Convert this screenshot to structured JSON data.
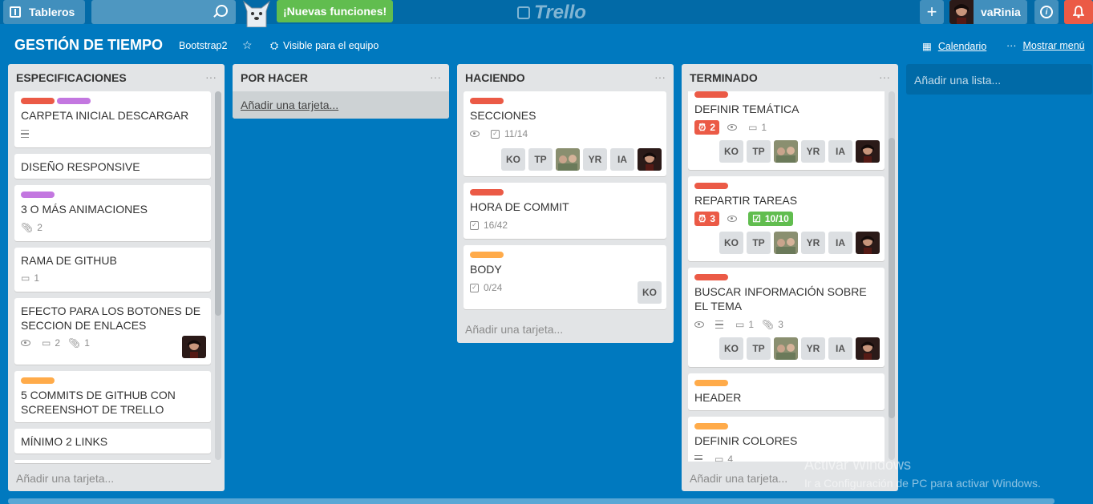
{
  "header": {
    "boards_label": "Tableros",
    "search_value": "",
    "new_features_label": "¡Nuevas funciones!",
    "logo_text": "Trello",
    "add_label": "+",
    "user_name": "vaRinia",
    "info_label": "i"
  },
  "board": {
    "title": "GESTIÓN DE TIEMPO",
    "team": "Bootstrap2",
    "visibility": "Visible para el equipo",
    "calendar_label": "Calendario",
    "menu_label": "Mostrar menú"
  },
  "colors": {
    "red": "#eb5a46",
    "purple": "#c377e0",
    "orange": "#ffab4a",
    "green": "#61bd4f",
    "background": "#0079bf"
  },
  "lists": [
    {
      "title": "ESPECIFICACIONES",
      "add_card": "Añadir una tarjeta...",
      "cards": [
        {
          "title": "CARPETA INICIAL DESCARGAR",
          "labels": [
            "red",
            "purple"
          ]
        },
        {
          "title": "DISEÑO RESPONSIVE"
        },
        {
          "title": "3 O MÁS ANIMACIONES",
          "labels": [
            "purple"
          ],
          "attachments": "2"
        },
        {
          "title": "RAMA DE GITHUB",
          "comments": "1"
        },
        {
          "title": "EFECTO PARA LOS BOTONES DE SECCION DE ENLACES",
          "comments": "2",
          "attachments": "1"
        },
        {
          "title": "5 COMMITS DE GITHUB CON SCREENSHOT DE TRELLO",
          "labels": [
            "orange"
          ]
        },
        {
          "title": "MÍNIMO 2 LINKS"
        }
      ]
    },
    {
      "title": "POR HACER",
      "add_card": "Añadir una tarjeta...",
      "cards": []
    },
    {
      "title": "HACIENDO",
      "add_card": "Añadir una tarjeta...",
      "cards": [
        {
          "title": "SECCIONES",
          "labels": [
            "red"
          ],
          "checklist": "11/14",
          "members": [
            "KO",
            "TP",
            "YR",
            "IA"
          ]
        },
        {
          "title": "HORA DE COMMIT",
          "labels": [
            "red"
          ],
          "checklist": "16/42"
        },
        {
          "title": "BODY",
          "labels": [
            "orange"
          ],
          "checklist": "0/24",
          "members": [
            "KO"
          ]
        }
      ]
    },
    {
      "title": "TERMINADO",
      "add_card": "Añadir una tarjeta...",
      "cards": [
        {
          "title": "DEFINIR TEMÁTICA",
          "labels": [
            "red"
          ],
          "due": "2",
          "comments": "1",
          "members": [
            "KO",
            "TP",
            "YR",
            "IA"
          ]
        },
        {
          "title": "REPARTIR TAREAS",
          "labels": [
            "red"
          ],
          "due": "3",
          "checklist": "10/10",
          "members": [
            "KO",
            "TP",
            "YR",
            "IA"
          ]
        },
        {
          "title": "BUSCAR INFORMACIÓN SOBRE EL TEMA",
          "labels": [
            "red"
          ],
          "comments": "1",
          "attachments": "3",
          "members": [
            "KO",
            "TP",
            "YR",
            "IA"
          ]
        },
        {
          "title": "HEADER",
          "labels": [
            "orange"
          ]
        },
        {
          "title": "DEFINIR COLORES",
          "labels": [
            "orange"
          ],
          "comments": "4"
        }
      ]
    }
  ],
  "add_list_label": "Añadir una lista...",
  "watermark": {
    "line1": "Activar Windows",
    "line2": "Ir a Configuración de PC para activar Windows."
  }
}
